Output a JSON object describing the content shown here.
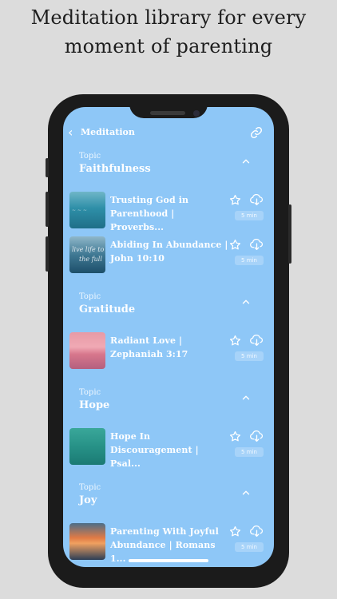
{
  "headline": {
    "line1": "Meditation library for every",
    "line2": "moment of parenting"
  },
  "nav": {
    "back_icon": "chevron-left-icon",
    "title": "Meditation",
    "share_icon": "link-icon"
  },
  "topics": [
    {
      "label": "Topic",
      "name": "Faithfulness",
      "items": [
        {
          "title": "Trusting God in Parenthood | Proverbs...",
          "duration": "5 min"
        },
        {
          "title": "Abiding In Abundance | John 10:10",
          "duration": "5 min"
        }
      ]
    },
    {
      "label": "Topic",
      "name": "Gratitude",
      "items": [
        {
          "title": "Radiant Love | Zephaniah 3:17",
          "duration": "5 min"
        }
      ]
    },
    {
      "label": "Topic",
      "name": "Hope",
      "items": [
        {
          "title": "Hope In Discouragement | Psal...",
          "duration": "5 min"
        }
      ]
    },
    {
      "label": "Topic",
      "name": "Joy",
      "items": [
        {
          "title": "Parenting With Joyful Abundance | Romans 1...",
          "duration": "5 min"
        }
      ]
    }
  ],
  "thumb_text": {
    "live": "live life to",
    "full": "the full"
  },
  "colors": {
    "screen_bg": "#8ec7f7",
    "text": "#ffffff",
    "duration_badge": "#a7d3f9"
  }
}
